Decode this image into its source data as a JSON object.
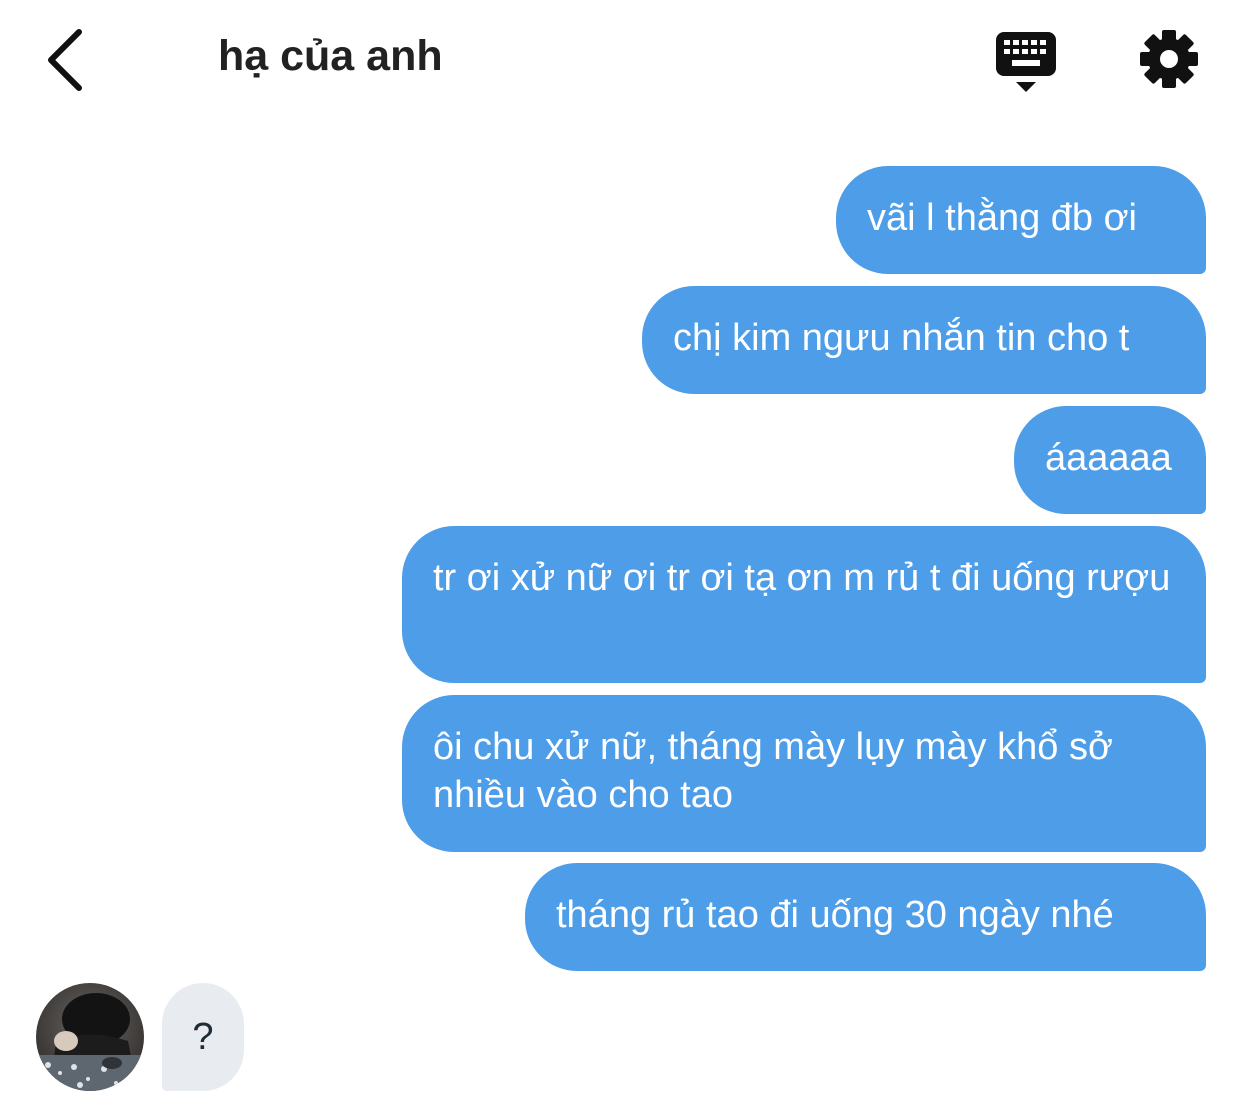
{
  "header": {
    "title": "hạ của anh",
    "back_icon": "chevron-left-icon",
    "keyboard_icon": "keyboard-icon",
    "settings_icon": "gear-icon"
  },
  "messages": [
    {
      "sender": "me",
      "text": "vãi l thằng đb ơi"
    },
    {
      "sender": "me",
      "text": "chị kim ngưu nhắn tin cho t"
    },
    {
      "sender": "me",
      "text": "áaaaaa"
    },
    {
      "sender": "me",
      "text": "tr ơi xử nữ ơi tr ơi tạ ơn m rủ t đi uống rượu"
    },
    {
      "sender": "me",
      "text": "ôi chu xử nữ, tháng mày lụy mày khổ sở nhiều vào cho tao"
    },
    {
      "sender": "me",
      "text": "tháng rủ tao đi uống 30 ngày nhé"
    },
    {
      "sender": "them",
      "text": "?"
    }
  ],
  "colors": {
    "outgoing_bubble": "#4d9de8",
    "incoming_bubble": "#e8ecf1",
    "title_text": "#222222"
  }
}
